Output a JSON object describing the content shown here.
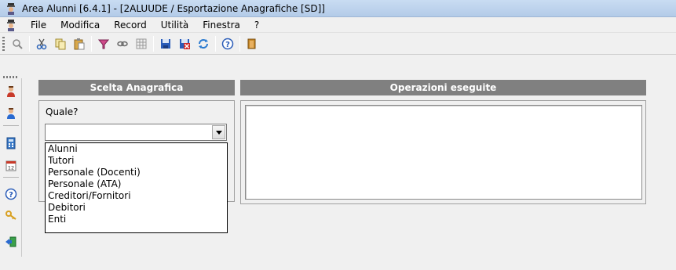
{
  "window": {
    "title": "Area Alunni [6.4.1] - [2ALUUDE / Esportazione Anagrafiche [SD]]"
  },
  "menu": {
    "items": [
      "File",
      "Modifica",
      "Record",
      "Utilità",
      "Finestra",
      "?"
    ]
  },
  "toolbar": {
    "icons": [
      "search-icon",
      "cut-icon",
      "copy-icon",
      "paste-icon",
      "filter-icon",
      "link-icon",
      "grid-icon",
      "save-icon",
      "save-close-icon",
      "refresh-icon",
      "help-icon",
      "exit-icon"
    ]
  },
  "sidebar": {
    "icons": [
      "user-red-icon",
      "user-blue-icon",
      "calculator-icon",
      "calendar-icon",
      "help-icon",
      "key-icon",
      "exit-icon"
    ]
  },
  "left_panel": {
    "header": "Scelta Anagrafica",
    "question_label": "Quale?",
    "combo_value": "",
    "options": [
      "Alunni",
      "Tutori",
      "Personale (Docenti)",
      "Personale (ATA)",
      "Creditori/Fornitori",
      "Debitori",
      "Enti"
    ]
  },
  "right_panel": {
    "header": "Operazioni eseguite",
    "log_text": ""
  }
}
